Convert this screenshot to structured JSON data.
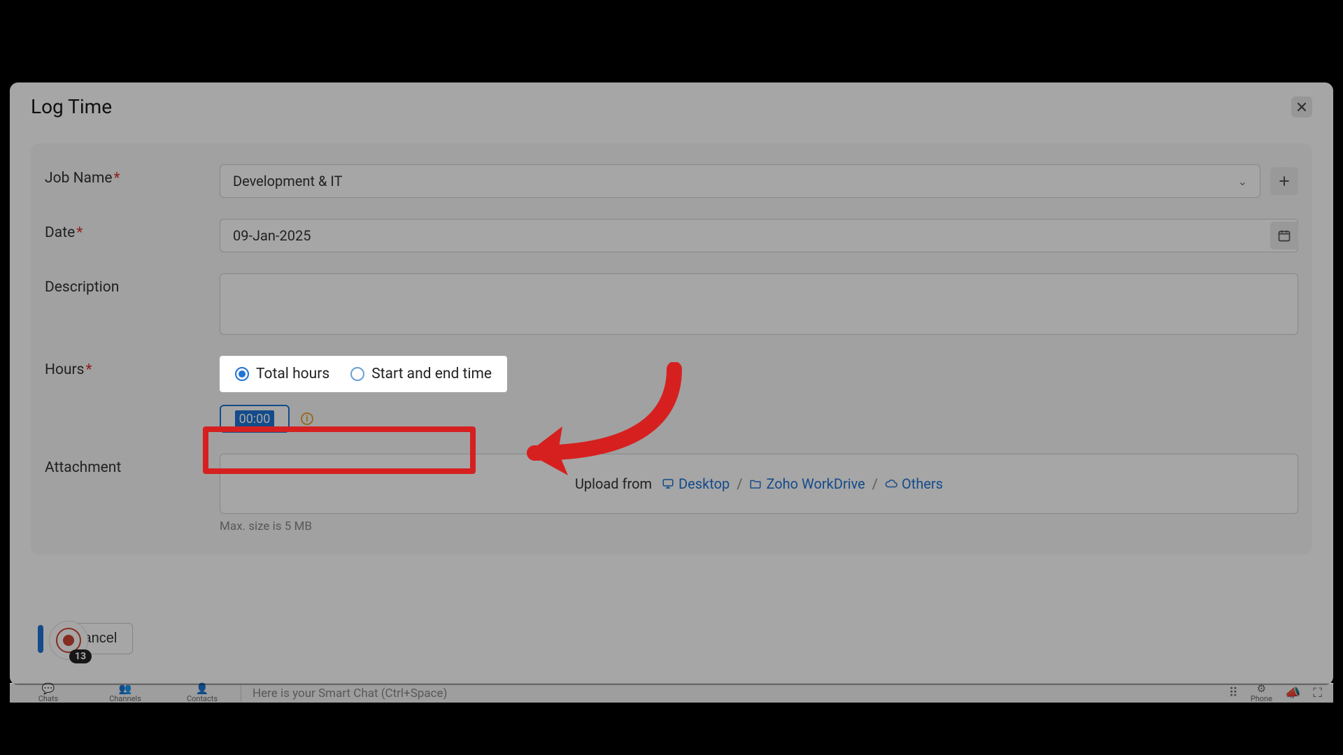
{
  "modal": {
    "title": "Log Time"
  },
  "form": {
    "job_name": {
      "label": "Job Name",
      "required": "*",
      "value": "Development & IT"
    },
    "date": {
      "label": "Date",
      "required": "*",
      "value": "09-Jan-2025"
    },
    "description": {
      "label": "Description",
      "value": ""
    },
    "hours": {
      "label": "Hours",
      "required": "*",
      "radio_total": "Total hours",
      "radio_range": "Start and end time",
      "input_value": "00:00"
    },
    "attachment": {
      "label": "Attachment",
      "upload_from": "Upload from",
      "desktop": "Desktop",
      "workdrive": "Zoho WorkDrive",
      "others": "Others",
      "sep": "/",
      "maxsize": "Max. size is 5 MB"
    }
  },
  "footer": {
    "cancel": "Cancel"
  },
  "chat": {
    "badge": "13"
  },
  "bottom_bar": {
    "chats": "Chats",
    "channels": "Channels",
    "contacts": "Contacts",
    "smart_chat_placeholder": "Here is your Smart Chat (Ctrl+Space)",
    "phone": "Phone"
  }
}
